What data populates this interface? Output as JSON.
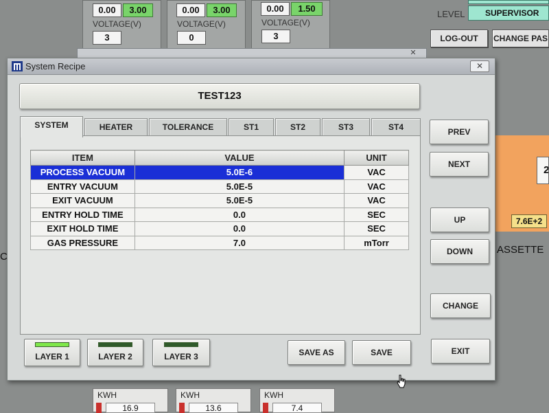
{
  "background": {
    "stations": [
      {
        "value_left": "0.00",
        "value_right": "3.00",
        "voltage_label": "VOLTAGE(V)",
        "voltage_value": "3"
      },
      {
        "value_left": "0.00",
        "value_right": "3.00",
        "voltage_label": "VOLTAGE(V)",
        "voltage_value": "0"
      },
      {
        "value_left": "0.00",
        "value_right": "1.50",
        "voltage_label": "VOLTAGE(V)",
        "voltage_value": "3"
      }
    ],
    "level_label": "LEVEL",
    "level_value": "SUPERVISOR",
    "logout_label": "LOG-OUT",
    "change_password_label": "CHANGE PAS",
    "side_value": "7.6E+2",
    "cassette_label": "ASSETTE",
    "left_fragment": "CA",
    "kwh": [
      {
        "label": "KWH",
        "value": "16.9"
      },
      {
        "label": "KWH",
        "value": "13.6"
      },
      {
        "label": "KWH",
        "value": "7.4"
      }
    ],
    "colors": {
      "green_field": "#79d46a",
      "teal_field": "#9ee6d0",
      "orange_panel": "#f2a35e",
      "yellow_value": "#f5e08a"
    }
  },
  "dialog": {
    "title": "System Recipe",
    "close_symbol": "✕",
    "recipe_name": "TEST123",
    "tabs": [
      {
        "label": "SYSTEM",
        "active": true
      },
      {
        "label": "HEATER",
        "active": false
      },
      {
        "label": "TOLERANCE",
        "active": false
      },
      {
        "label": "ST1",
        "active": false
      },
      {
        "label": "ST2",
        "active": false
      },
      {
        "label": "ST3",
        "active": false
      },
      {
        "label": "ST4",
        "active": false
      }
    ],
    "table": {
      "headers": [
        "ITEM",
        "VALUE",
        "UNIT"
      ],
      "rows": [
        {
          "item": "PROCESS VACUUM",
          "value": "5.0E-6",
          "unit": "VAC",
          "selected": true
        },
        {
          "item": "ENTRY VACUUM",
          "value": "5.0E-5",
          "unit": "VAC",
          "selected": false
        },
        {
          "item": "EXIT VACUUM",
          "value": "5.0E-5",
          "unit": "VAC",
          "selected": false
        },
        {
          "item": "ENTRY HOLD TIME",
          "value": "0.0",
          "unit": "SEC",
          "selected": false
        },
        {
          "item": "EXIT HOLD TIME",
          "value": "0.0",
          "unit": "SEC",
          "selected": false
        },
        {
          "item": "GAS PRESSURE",
          "value": "7.0",
          "unit": "mTorr",
          "selected": false
        }
      ]
    },
    "side_buttons": {
      "prev": "PREV",
      "next": "NEXT",
      "up": "UP",
      "down": "DOWN",
      "change": "CHANGE",
      "exit": "EXIT"
    },
    "layers": [
      {
        "label": "LAYER 1",
        "active": true
      },
      {
        "label": "LAYER 2",
        "active": false
      },
      {
        "label": "LAYER 3",
        "active": false
      }
    ],
    "save_as_label": "SAVE AS",
    "save_label": "SAVE",
    "colors": {
      "selection": "#1a2fd6",
      "led_on": "#7fe84a",
      "led_off": "#2f5a2a"
    }
  }
}
